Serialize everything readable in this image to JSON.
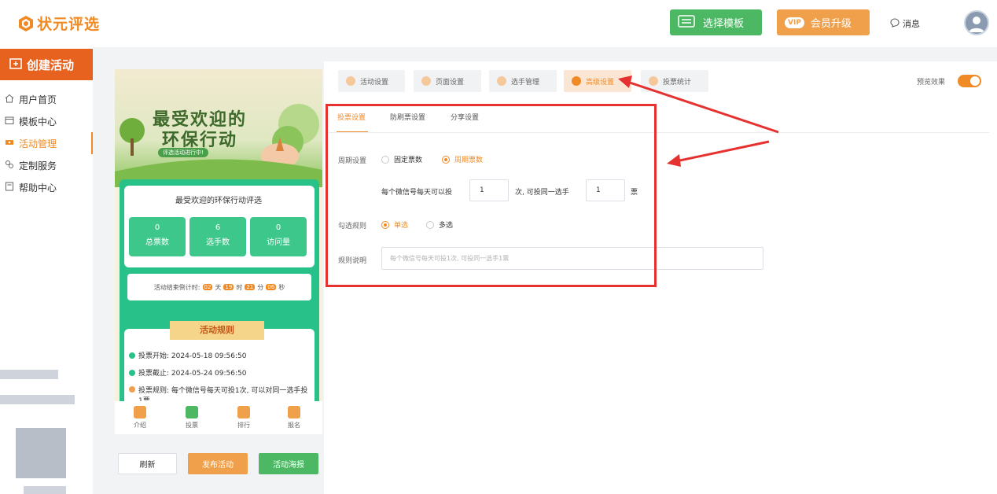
{
  "header": {
    "logo": "状元评选",
    "template_btn": "选择模板",
    "vip_badge": "VIP",
    "vip_btn": "会员升级",
    "message": "消息"
  },
  "sidebar": {
    "create": "创建活动",
    "items": [
      {
        "label": "用户首页",
        "icon": "home-icon"
      },
      {
        "label": "模板中心",
        "icon": "folder-icon"
      },
      {
        "label": "活动管理",
        "icon": "ticket-icon",
        "active": true
      },
      {
        "label": "定制服务",
        "icon": "service-icon"
      },
      {
        "label": "帮助中心",
        "icon": "help-icon"
      }
    ]
  },
  "preview": {
    "banner_title_1": "最受欢迎的",
    "banner_title_2": "环保行动",
    "banner_tag": "评选活动进行中!",
    "card_title": "最受欢迎的环保行动评选",
    "stats": [
      {
        "value": "0",
        "label": "总票数"
      },
      {
        "value": "6",
        "label": "选手数"
      },
      {
        "value": "0",
        "label": "访问量"
      }
    ],
    "countdown_label": "活动结束倒计时:",
    "countdown": [
      {
        "v": "02",
        "u": "天"
      },
      {
        "v": "19",
        "u": "时"
      },
      {
        "v": "21",
        "u": "分"
      },
      {
        "v": "06",
        "u": "秒"
      }
    ],
    "rules_title": "活动规则",
    "rules": [
      "投票开始: 2024-05-18 09:56:50",
      "投票截止: 2024-05-24 09:56:50",
      "投票规则: 每个微信号每天可投1次, 可以对同一选手投1票"
    ],
    "bottom_nav": [
      "介绍",
      "投票",
      "排行",
      "报名"
    ],
    "buttons": {
      "refresh": "刷新",
      "publish": "发布活动",
      "poster": "活动海报"
    }
  },
  "tabs": [
    "活动设置",
    "页面设置",
    "选手管理",
    "高级设置",
    "投票统计"
  ],
  "preview_toggle": "预览效果",
  "subtabs": [
    "投票设置",
    "防刷票设置",
    "分享设置"
  ],
  "form": {
    "period_label": "周期设置",
    "period_fixed": "固定票数",
    "period_cycle": "周期票数",
    "per_day_prefix": "每个微信号每天可以投",
    "times_value": "1",
    "times_suffix": "次, 可投同一选手",
    "votes_value": "1",
    "votes_suffix": "票",
    "select_label": "勾选规则",
    "single": "单选",
    "multi": "多选",
    "desc_label": "规则说明",
    "desc_placeholder": "每个微信号每天可投1次, 可投同一选手1票"
  },
  "colors": {
    "accent": "#f08a24",
    "green": "#4cb863",
    "annotation": "#e5312f"
  }
}
